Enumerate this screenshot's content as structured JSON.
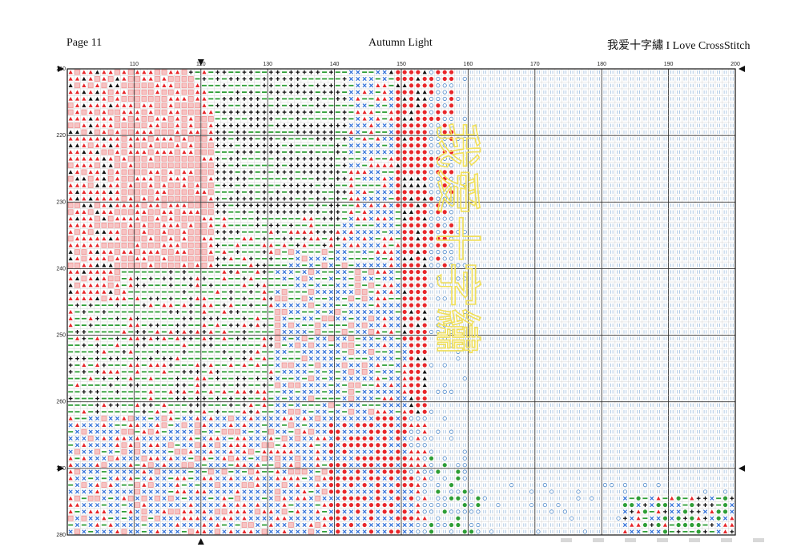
{
  "header": {
    "page_label": "Page 11",
    "title": "Autumn Light",
    "brand": "我爱十字繡 I Love CrossStitch"
  },
  "chart_data": {
    "type": "table",
    "x_axis": {
      "start": 100,
      "end": 200,
      "tick_step": 10,
      "labels": [
        "110",
        "120",
        "130",
        "140",
        "150",
        "160",
        "170",
        "180",
        "190",
        "200"
      ]
    },
    "y_axis": {
      "start": 210,
      "end": 280,
      "tick_step": 10,
      "labels": [
        "210",
        "220",
        "230",
        "240",
        "250",
        "260",
        "270",
        "280"
      ]
    },
    "center_markers": {
      "column": 120,
      "row": 270
    },
    "watermark": "我爱十字繡",
    "legend_symbols": [
      {
        "name": "red-triangle",
        "color": "#e8262a"
      },
      {
        "name": "red-circle",
        "color": "#e8262a"
      },
      {
        "name": "black-cross",
        "color": "#111111"
      },
      {
        "name": "black-triangle",
        "color": "#111111"
      },
      {
        "name": "green-dash",
        "color": "#2e9e36"
      },
      {
        "name": "blue-x",
        "color": "#2f6fd8"
      },
      {
        "name": "blue-ring",
        "color": "#4a86c8"
      },
      {
        "name": "pale-blue-bars",
        "color": "#8fb3d9"
      },
      {
        "name": "pink-square",
        "color": "#f08a8a"
      },
      {
        "name": "green-dot",
        "color": "#2e9e36"
      }
    ]
  }
}
